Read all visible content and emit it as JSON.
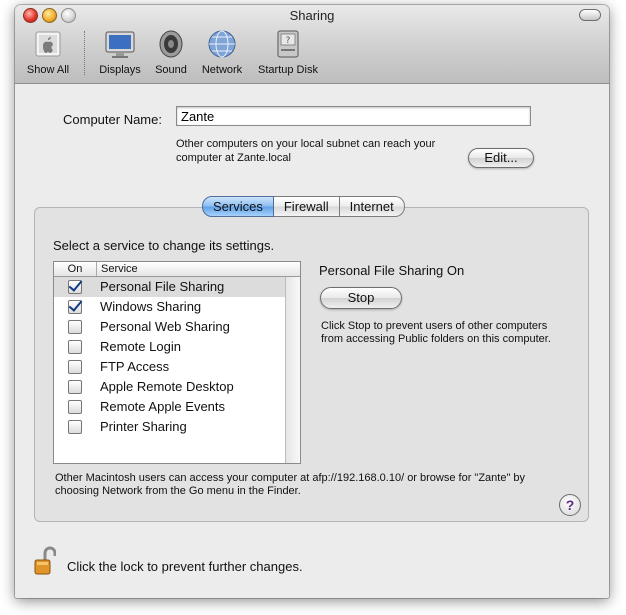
{
  "window": {
    "title": "Sharing"
  },
  "toolbar": {
    "items": [
      {
        "label": "Show All",
        "icon": "apple-icon"
      },
      {
        "label": "Displays",
        "icon": "display-icon"
      },
      {
        "label": "Sound",
        "icon": "speaker-icon"
      },
      {
        "label": "Network",
        "icon": "globe-icon"
      },
      {
        "label": "Startup Disk",
        "icon": "disk-icon"
      }
    ]
  },
  "computer_name": {
    "label": "Computer Name:",
    "value": "Zante",
    "description": "Other computers on your local subnet can reach your computer at Zante.local",
    "edit_button": "Edit..."
  },
  "tabs": [
    {
      "label": "Services",
      "active": true
    },
    {
      "label": "Firewall",
      "active": false
    },
    {
      "label": "Internet",
      "active": false
    }
  ],
  "services": {
    "prompt": "Select a service to change its settings.",
    "header_on": "On",
    "header_service": "Service",
    "items": [
      {
        "label": "Personal File Sharing",
        "on": true,
        "selected": true
      },
      {
        "label": "Windows Sharing",
        "on": true,
        "selected": false
      },
      {
        "label": "Personal Web Sharing",
        "on": false,
        "selected": false
      },
      {
        "label": "Remote Login",
        "on": false,
        "selected": false
      },
      {
        "label": "FTP Access",
        "on": false,
        "selected": false
      },
      {
        "label": "Apple Remote Desktop",
        "on": false,
        "selected": false
      },
      {
        "label": "Remote Apple Events",
        "on": false,
        "selected": false
      },
      {
        "label": "Printer Sharing",
        "on": false,
        "selected": false
      }
    ]
  },
  "status": {
    "title": "Personal File Sharing On",
    "button": "Stop",
    "description": "Click Stop to prevent users of other computers from accessing Public folders on this computer."
  },
  "footer": {
    "description": "Other Macintosh users can access your computer at afp://192.168.0.10/ or browse for \"Zante\" by choosing Network from the Go menu in the Finder.",
    "help": "?"
  },
  "lock": {
    "text": "Click the lock to prevent further changes."
  }
}
